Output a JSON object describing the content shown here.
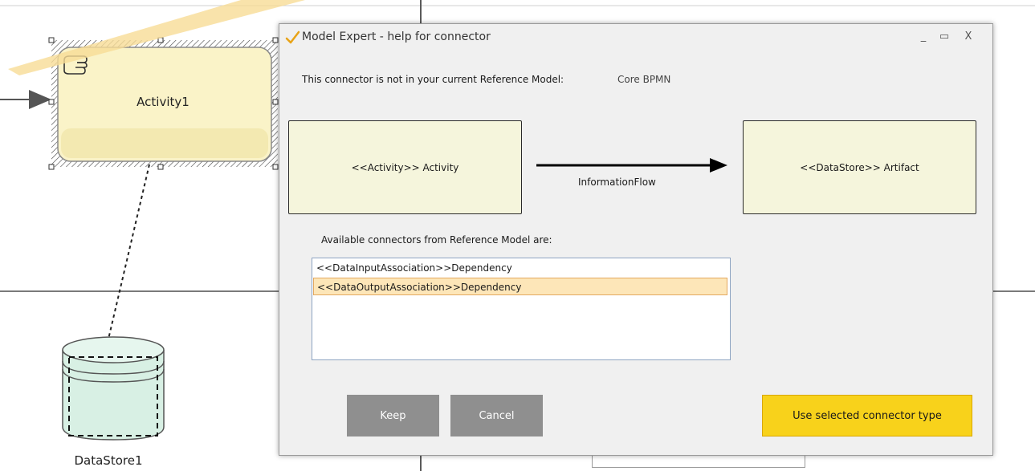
{
  "diagram": {
    "activity_label": "Activity1",
    "datastore_label": "DataStore1"
  },
  "dialog": {
    "title": "Model Expert - help for connector",
    "title_icon": "checkmark-icon",
    "window_buttons": {
      "minimize": "_",
      "maximize": "▭",
      "close": "X"
    },
    "info_text": "This connector is not in your current Reference Model:",
    "reference_model": "Core BPMN",
    "source_node": "<<Activity>> Activity",
    "target_node": "<<DataStore>> Artifact",
    "flow_label": "InformationFlow",
    "list_label": "Available connectors from Reference Model are:",
    "connectors": [
      {
        "label": "<<DataInputAssociation>>Dependency",
        "selected": false
      },
      {
        "label": "<<DataOutputAssociation>>Dependency",
        "selected": true
      }
    ],
    "keep_label": "Keep",
    "cancel_label": "Cancel",
    "use_label": "Use selected connector type"
  },
  "colors": {
    "node_fill": "#f5f5dc",
    "activity_fill": "#faf3c8",
    "datastore_fill": "#d8f0e4",
    "selected_row": "#fde6b8",
    "primary_button": "#f8d21b",
    "secondary_button": "#8f8f8f"
  }
}
